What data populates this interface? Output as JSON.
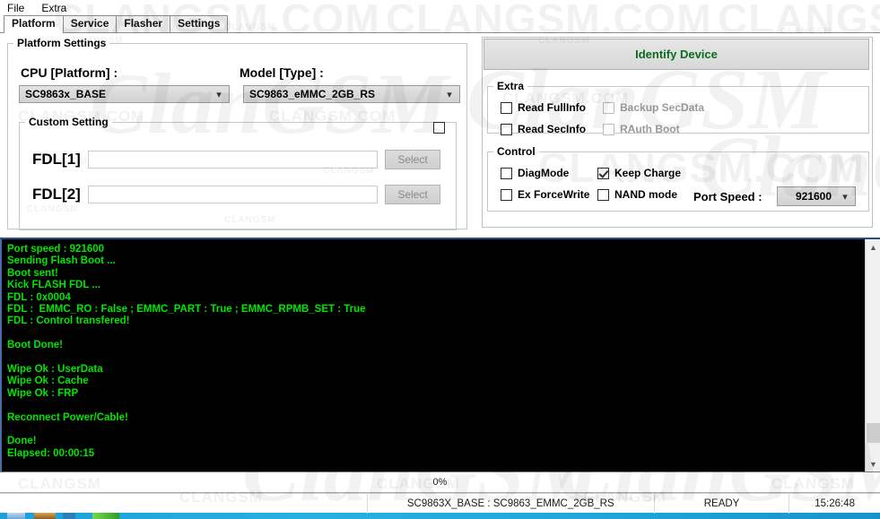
{
  "window": {
    "menu": [
      {
        "label": "File"
      },
      {
        "label": "Extra"
      }
    ],
    "tabs": [
      {
        "label": "Platform",
        "active": true
      },
      {
        "label": "Service",
        "active": false
      },
      {
        "label": "Flasher",
        "active": false
      },
      {
        "label": "Settings",
        "active": false
      }
    ]
  },
  "platform_settings": {
    "legend": "Platform Settings",
    "cpu_label": "CPU [Platform] :",
    "cpu_value": "SC9863x_BASE",
    "model_label": "Model [Type] :",
    "model_value": "SC9863_eMMC_2GB_RS",
    "custom_setting": {
      "legend": "Custom Setting",
      "enabled": false,
      "fdl1_label": "FDL[1]",
      "fdl1_value": "",
      "fdl1_button": "Select",
      "fdl2_label": "FDL[2]",
      "fdl2_value": "",
      "fdl2_button": "Select"
    }
  },
  "right_panel": {
    "identify_button": "Identify Device",
    "identify_color": "#0a6b1e",
    "extra": {
      "legend": "Extra",
      "items": [
        {
          "label": "Read FullInfo",
          "checked": false,
          "disabled": false
        },
        {
          "label": "Backup SecData",
          "checked": false,
          "disabled": true
        },
        {
          "label": "Read SecInfo",
          "checked": false,
          "disabled": false
        },
        {
          "label": "RAuth Boot",
          "checked": false,
          "disabled": true
        }
      ]
    },
    "control": {
      "legend": "Control",
      "items": [
        {
          "label": "DiagMode",
          "checked": false,
          "disabled": false
        },
        {
          "label": "Keep Charge",
          "checked": true,
          "disabled": false
        },
        {
          "label": "Ex ForceWrite",
          "checked": false,
          "disabled": false
        },
        {
          "label": "NAND mode",
          "checked": false,
          "disabled": false
        }
      ],
      "port_speed_label": "Port Speed :",
      "port_speed_value": "921600"
    }
  },
  "console": {
    "text_color": "#00e600",
    "lines": [
      "Port speed : 921600",
      "Sending Flash Boot ...",
      "Boot sent!",
      "Kick FLASH FDL ...",
      "FDL : 0x0004",
      "FDL :  EMMC_RO : False ; EMMC_PART : True ; EMMC_RPMB_SET : True",
      "FDL : Control transfered!",
      "",
      "Boot Done!",
      "",
      "Wipe Ok : UserData",
      "Wipe Ok : Cache",
      "Wipe Ok : FRP",
      "",
      "Reconnect Power/Cable!",
      "",
      "Done!",
      "Elapsed: 00:00:15"
    ]
  },
  "progress": {
    "percent_label": "0%",
    "value": 0
  },
  "statusbar": {
    "device": "SC9863X_BASE : SC9863_EMMC_2GB_RS",
    "state": "READY",
    "time": "15:26:48"
  },
  "watermarks": {
    "domain": "CLANGSM.COM",
    "short": "CLANGSM",
    "logo": "ClanGSM"
  }
}
